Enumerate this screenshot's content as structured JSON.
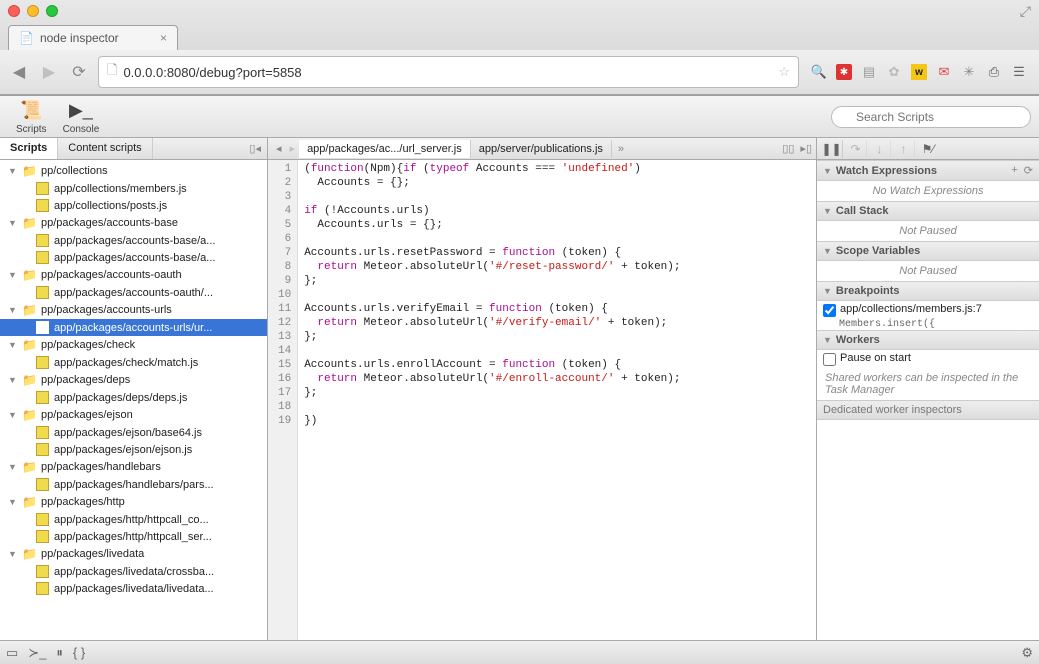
{
  "browser": {
    "tab_title": "node inspector",
    "url": "0.0.0.0:8080/debug?port=5858"
  },
  "toolbar": {
    "scripts_label": "Scripts",
    "console_label": "Console",
    "search_placeholder": "Search Scripts"
  },
  "left": {
    "tabs": {
      "scripts": "Scripts",
      "content": "Content scripts"
    },
    "tree": [
      {
        "type": "folder",
        "label": "pp/collections"
      },
      {
        "type": "file",
        "label": "app/collections/members.js"
      },
      {
        "type": "file",
        "label": "app/collections/posts.js"
      },
      {
        "type": "folder",
        "label": "pp/packages/accounts-base"
      },
      {
        "type": "file",
        "label": "app/packages/accounts-base/a..."
      },
      {
        "type": "file",
        "label": "app/packages/accounts-base/a..."
      },
      {
        "type": "folder",
        "label": "pp/packages/accounts-oauth"
      },
      {
        "type": "file",
        "label": "app/packages/accounts-oauth/..."
      },
      {
        "type": "folder",
        "label": "pp/packages/accounts-urls"
      },
      {
        "type": "file",
        "label": "app/packages/accounts-urls/ur...",
        "selected": true
      },
      {
        "type": "folder",
        "label": "pp/packages/check"
      },
      {
        "type": "file",
        "label": "app/packages/check/match.js"
      },
      {
        "type": "folder",
        "label": "pp/packages/deps"
      },
      {
        "type": "file",
        "label": "app/packages/deps/deps.js"
      },
      {
        "type": "folder",
        "label": "pp/packages/ejson"
      },
      {
        "type": "file",
        "label": "app/packages/ejson/base64.js"
      },
      {
        "type": "file",
        "label": "app/packages/ejson/ejson.js"
      },
      {
        "type": "folder",
        "label": "pp/packages/handlebars"
      },
      {
        "type": "file",
        "label": "app/packages/handlebars/pars..."
      },
      {
        "type": "folder",
        "label": "pp/packages/http"
      },
      {
        "type": "file",
        "label": "app/packages/http/httpcall_co..."
      },
      {
        "type": "file",
        "label": "app/packages/http/httpcall_ser..."
      },
      {
        "type": "folder",
        "label": "pp/packages/livedata"
      },
      {
        "type": "file",
        "label": "app/packages/livedata/crossba..."
      },
      {
        "type": "file",
        "label": "app/packages/livedata/livedata..."
      }
    ]
  },
  "editor": {
    "tabs": [
      {
        "label": "app/packages/ac.../url_server.js",
        "active": true
      },
      {
        "label": "app/server/publications.js",
        "active": false
      }
    ],
    "lines": [
      "(function(Npm){if (typeof Accounts === 'undefined')",
      "  Accounts = {};",
      "",
      "if (!Accounts.urls)",
      "  Accounts.urls = {};",
      "",
      "Accounts.urls.resetPassword = function (token) {",
      "  return Meteor.absoluteUrl('#/reset-password/' + token);",
      "};",
      "",
      "Accounts.urls.verifyEmail = function (token) {",
      "  return Meteor.absoluteUrl('#/verify-email/' + token);",
      "};",
      "",
      "Accounts.urls.enrollAccount = function (token) {",
      "  return Meteor.absoluteUrl('#/enroll-account/' + token);",
      "};",
      "",
      "})"
    ]
  },
  "right": {
    "watch": {
      "title": "Watch Expressions",
      "empty": "No Watch Expressions"
    },
    "callstack": {
      "title": "Call Stack",
      "status": "Not Paused"
    },
    "scope": {
      "title": "Scope Variables",
      "status": "Not Paused"
    },
    "breakpoints": {
      "title": "Breakpoints",
      "item": "app/collections/members.js:7",
      "snippet": "Members.insert({"
    },
    "workers": {
      "title": "Workers",
      "pause_label": "Pause on start",
      "hint": "Shared workers can be inspected in the Task Manager",
      "dedicated": "Dedicated worker inspectors"
    }
  }
}
